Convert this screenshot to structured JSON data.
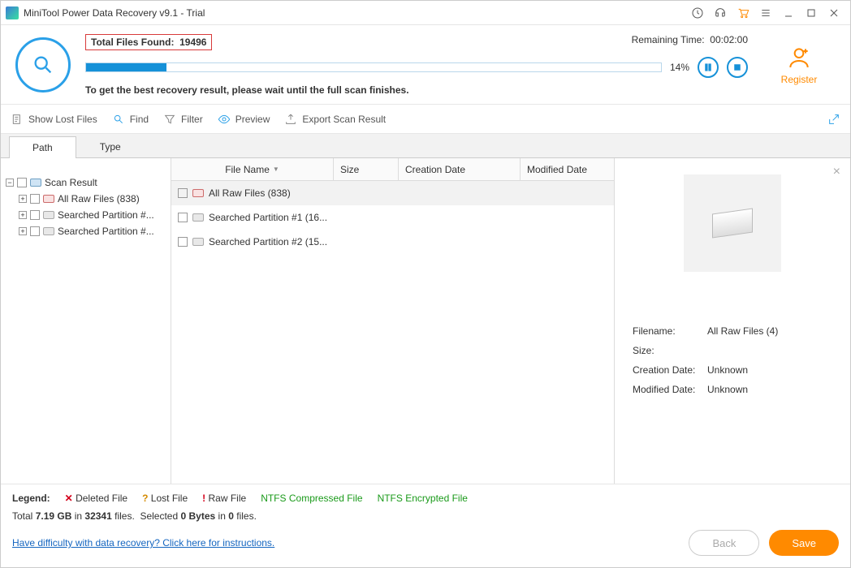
{
  "title": "MiniTool Power Data Recovery v9.1 - Trial",
  "scan": {
    "total_label": "Total Files Found:",
    "total_count": "19496",
    "remaining_label": "Remaining Time:",
    "remaining_value": "00:02:00",
    "percent": "14%",
    "progress_width": "14%",
    "msg": "To get the best recovery result, please wait until the full scan finishes."
  },
  "register_label": "Register",
  "toolbar": {
    "show_lost": "Show Lost Files",
    "find": "Find",
    "filter": "Filter",
    "preview": "Preview",
    "export": "Export Scan Result"
  },
  "tabs": {
    "path": "Path",
    "type": "Type"
  },
  "tree": {
    "root": "Scan Result",
    "raw": "All Raw Files (838)",
    "sp1": "Searched Partition #...",
    "sp2": "Searched Partition #..."
  },
  "columns": {
    "fn": "File Name",
    "sz": "Size",
    "cd": "Creation Date",
    "md": "Modified Date"
  },
  "rows": {
    "r0": "All Raw Files (838)",
    "r1": "Searched Partition #1 (16...",
    "r2": "Searched Partition #2 (15..."
  },
  "detail": {
    "filename_label": "Filename:",
    "filename_value": "All Raw Files (4)",
    "size_label": "Size:",
    "size_value": "",
    "cd_label": "Creation Date:",
    "cd_value": "Unknown",
    "md_label": "Modified Date:",
    "md_value": "Unknown"
  },
  "legend": {
    "label": "Legend:",
    "deleted": "Deleted File",
    "lost": "Lost File",
    "raw": "Raw File",
    "ntfs_c": "NTFS Compressed File",
    "ntfs_e": "NTFS Encrypted File"
  },
  "stats": {
    "total_size": "7.19 GB",
    "total_files": "32341",
    "sel_bytes": "0 Bytes",
    "sel_files": "0"
  },
  "help_link": "Have difficulty with data recovery? Click here for instructions.",
  "buttons": {
    "back": "Back",
    "save": "Save"
  }
}
